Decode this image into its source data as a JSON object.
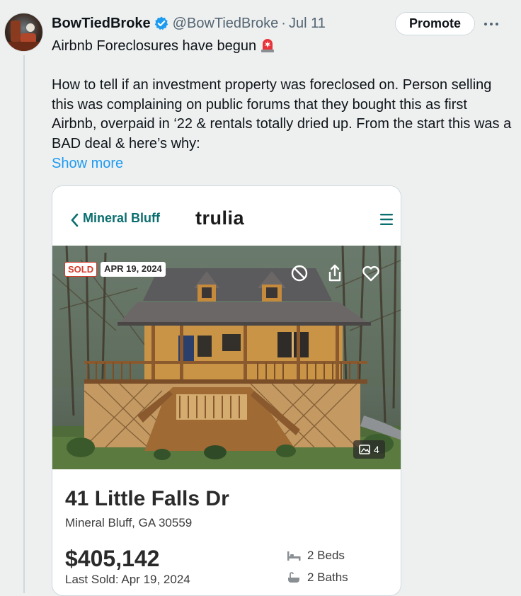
{
  "tweet": {
    "author_name": "BowTiedBroke",
    "handle": "@BowTiedBroke",
    "separator": "·",
    "date": "Jul 11",
    "promote_label": "Promote",
    "headline": "Airbnb Foreclosures have begun",
    "body": "How to tell if an investment property was foreclosed on. Person selling this was complaining on public forums that they bought this as first Airbnb, overpaid in ‘22 & rentals totally dried up. From the start this was a BAD deal & here’s why:",
    "show_more": "Show more",
    "icons": [
      "verified-badge-icon",
      "siren-icon",
      "more-icon"
    ],
    "accent_color": "#1d9bf0"
  },
  "listing": {
    "nav_back_label": "Mineral Bluff",
    "brand": "trulia",
    "sold_badge": "SOLD",
    "sold_date_badge": "APR 19, 2024",
    "photo_count": "4",
    "address": "41 Little Falls Dr",
    "city_state_zip": "Mineral Bluff, GA 30559",
    "price": "$405,142",
    "last_sold": "Last Sold: Apr 19, 2024",
    "beds": "2 Beds",
    "baths": "2 Baths",
    "icons": [
      "back-chevron-icon",
      "menu-icon",
      "hide-icon",
      "share-icon",
      "heart-icon",
      "gallery-icon",
      "bed-icon",
      "bath-icon"
    ],
    "brand_color": "#0a6e6f"
  }
}
